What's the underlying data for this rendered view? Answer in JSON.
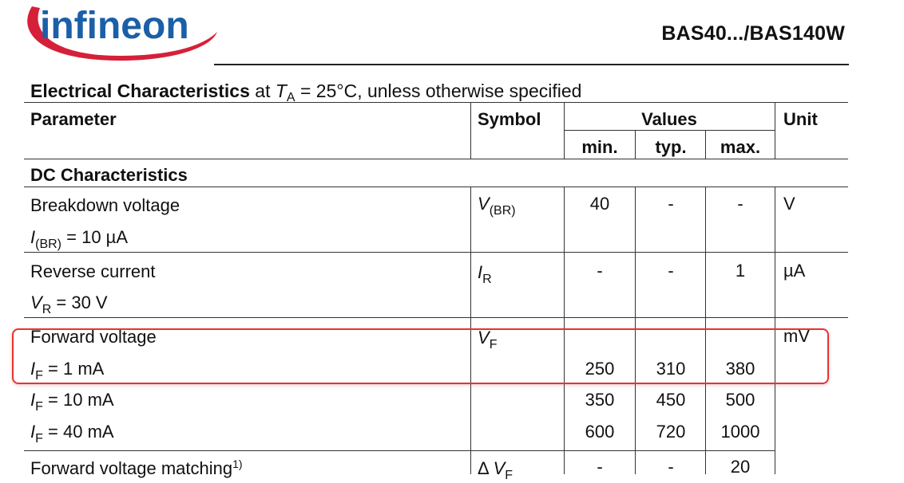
{
  "logo_text": "infineon",
  "part_number": "BAS40.../BAS140W",
  "section_title": {
    "bold": "Electrical Characteristics",
    "at": "at",
    "t_symbol": "T",
    "t_sub": "A",
    "rest": "= 25°C, unless otherwise specified"
  },
  "table": {
    "headers": {
      "parameter": "Parameter",
      "symbol": "Symbol",
      "values": "Values",
      "unit": "Unit",
      "min": "min.",
      "typ": "typ.",
      "max": "max."
    },
    "group_heading": "DC Characteristics",
    "rows": {
      "breakdown": {
        "param": "Breakdown voltage",
        "cond_sym": "I",
        "cond_sub": "(BR)",
        "cond_val": "= 10 µA",
        "sym": "V",
        "sym_sub": "(BR)",
        "min": "40",
        "typ": "-",
        "max": "-",
        "unit": "V"
      },
      "reverse": {
        "param": "Reverse current",
        "cond_sym": "V",
        "cond_sub": "R",
        "cond_val": "= 30 V",
        "sym": "I",
        "sym_sub": "R",
        "min": "-",
        "typ": "-",
        "max": "1",
        "unit": "µA"
      },
      "forward": {
        "param": "Forward voltage",
        "sym": "V",
        "sym_sub": "F",
        "unit": "mV",
        "conditions": [
          {
            "cond_sym": "I",
            "cond_sub": "F",
            "cond_val": "= 1 mA",
            "min": "250",
            "typ": "310",
            "max": "380"
          },
          {
            "cond_sym": "I",
            "cond_sub": "F",
            "cond_val": "= 10 mA",
            "min": "350",
            "typ": "450",
            "max": "500"
          },
          {
            "cond_sym": "I",
            "cond_sub": "F",
            "cond_val": "= 40 mA",
            "min": "600",
            "typ": "720",
            "max": "1000"
          }
        ]
      },
      "matching": {
        "param": "Forward voltage matching",
        "footnote": "1)",
        "sym_prefix": "Δ",
        "sym": "V",
        "sym_sub": "F",
        "min": "-",
        "typ": "-",
        "max": "20"
      }
    }
  },
  "highlight_color": "#e53535",
  "logo_color": "#1b5fa8",
  "swoosh_color": "#d6203a"
}
